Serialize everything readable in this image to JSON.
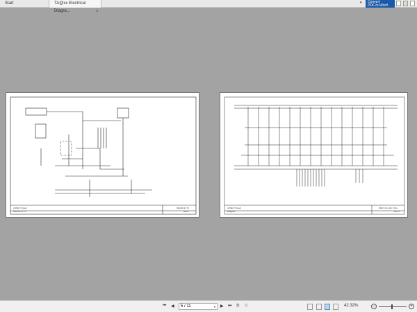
{
  "tabs": [
    {
      "label": "Start"
    },
    {
      "label": "TA@xx Electrical Diagra...",
      "close": "x"
    }
  ],
  "convert_banner": {
    "line1": "Convert",
    "line2": "PDF to Word"
  },
  "pages": [
    {
      "title": "ASSET Project",
      "subtitle": "SDH18-11 T1",
      "code": "SDH18-11 T1",
      "rev": "Rev 0"
    },
    {
      "title": "ASSET Project",
      "subtitle": "Diagram",
      "code": "SDH7-01 AAC-YGG",
      "rev": "Rev 0"
    }
  ],
  "status": {
    "page_value": "5 / 11",
    "zoom": "42.32%"
  }
}
